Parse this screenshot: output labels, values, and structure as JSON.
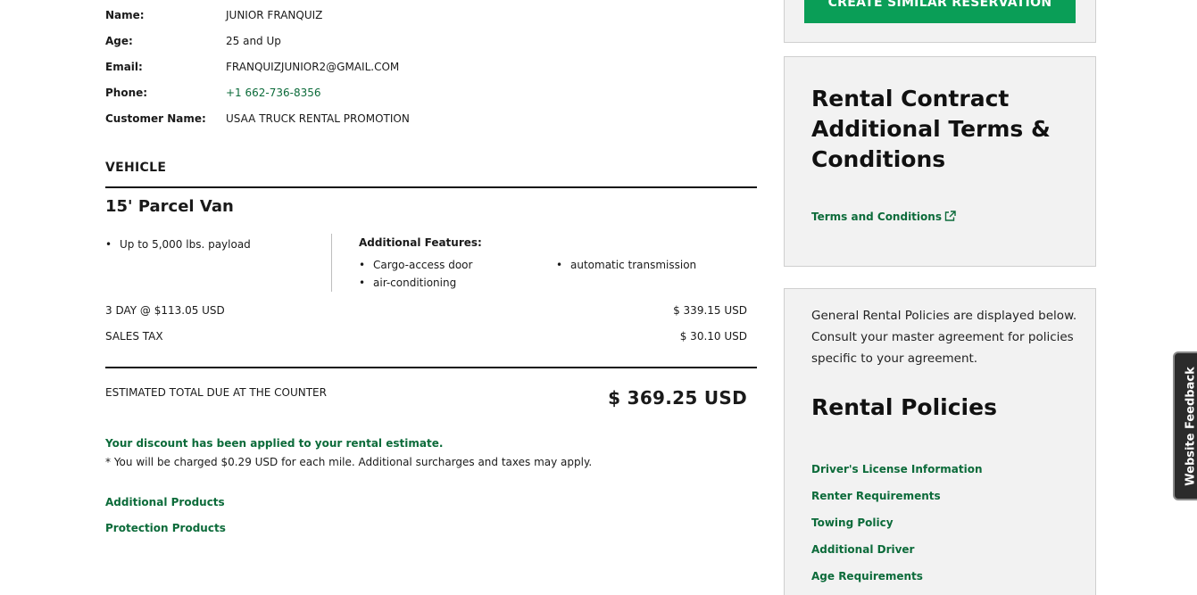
{
  "customer": {
    "name_label": "Name:",
    "name_value": "JUNIOR FRANQUIZ",
    "age_label": "Age:",
    "age_value": "25 and Up",
    "email_label": "Email:",
    "email_value": "FRANQUIZJUNIOR2@GMAIL.COM",
    "phone_label": "Phone:",
    "phone_value": "+1 662-736-8356",
    "customer_name_label": "Customer Name:",
    "customer_name_value": "USAA TRUCK RENTAL PROMOTION"
  },
  "vehicle": {
    "section_title": "VEHICLE",
    "name": "15' Parcel Van",
    "specs": [
      "Up to 5,000 lbs. payload"
    ],
    "features_heading": "Additional Features:",
    "features": [
      "Cargo-access door",
      "air-conditioning",
      "automatic transmission"
    ]
  },
  "pricing": {
    "rate_label": "3 DAY @ $113.05 USD",
    "rate_value": "$ 339.15 USD",
    "tax_label": "SALES TAX",
    "tax_value": "$ 30.10 USD",
    "total_label": "ESTIMATED TOTAL DUE AT THE COUNTER",
    "total_value": "$ 369.25 USD",
    "discount_note": "Your discount has been applied to your rental estimate.",
    "mileage_note": "* You will be charged $0.29 USD for each mile.  Additional surcharges and taxes may apply."
  },
  "links": {
    "additional_products": "Additional Products",
    "protection_products": "Protection Products"
  },
  "sidebar": {
    "cta_label": "CREATE SIMILAR RESERVATION",
    "terms_title": "Rental Contract Additional Terms & Conditions",
    "terms_link": "Terms and Conditions",
    "policy_intro": "General Rental Policies are displayed below. Consult your master agreement for policies specific to your agreement.",
    "policies_title": "Rental Policies",
    "policy_links": [
      "Driver's License Information",
      "Renter Requirements",
      "Towing Policy",
      "Additional Driver",
      "Age Requirements"
    ]
  },
  "feedback": {
    "label": "Website Feedback"
  },
  "colors": {
    "brand_green": "#0a9e57",
    "link_green": "#0c6b3a",
    "panel_bg": "#f2f2f2"
  }
}
